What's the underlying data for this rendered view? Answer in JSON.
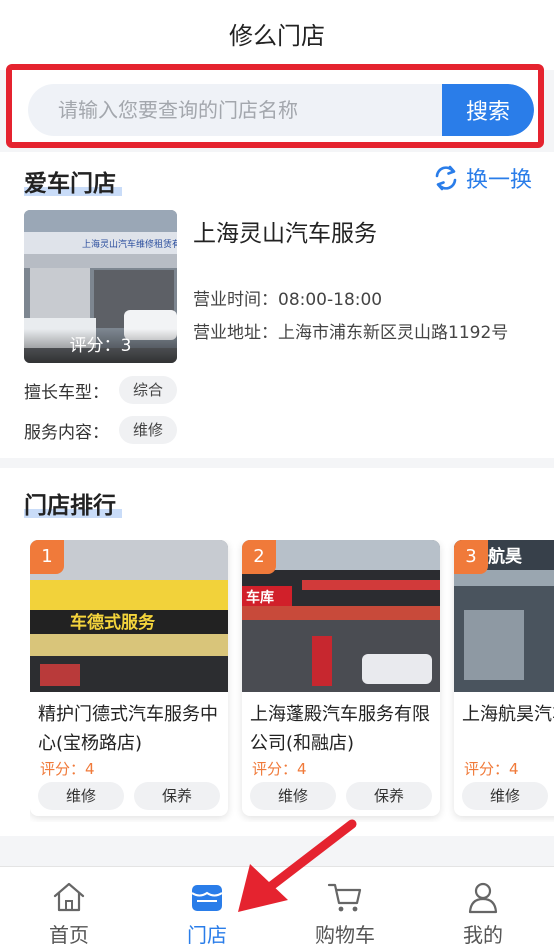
{
  "header": {
    "title": "修么门店"
  },
  "search": {
    "placeholder": "请输入您要查询的门店名称",
    "button_label": "搜索"
  },
  "favorite": {
    "section_title": "爱车门店",
    "swap_label": "换一换",
    "store": {
      "name": "上海灵山汽车服务",
      "rating_text": "评分：3",
      "hours": "营业时间：08:00-18:00",
      "address": "营业地址：上海市浦东新区灵山路1192号",
      "sign_text": "上海灵山汽车维修租赁有限公司",
      "specialty_label": "擅长车型：",
      "specialty_tag": "综合",
      "service_label": "服务内容：",
      "service_tag": "维修"
    }
  },
  "ranking": {
    "section_title": "门店排行",
    "items": [
      {
        "rank": "1",
        "name": "精护门德式汽车服务中心(宝杨路店)",
        "rating": "评分：4",
        "tags": [
          "维修",
          "保养"
        ],
        "sign_text": "车德式服务"
      },
      {
        "rank": "2",
        "name": "上海蓬殿汽车服务有限公司(和融店)",
        "rating": "评分：4",
        "tags": [
          "维修",
          "保养"
        ],
        "sign_text": "车库"
      },
      {
        "rank": "3",
        "name": "上海航昊汽车维修中心",
        "rating": "评分：4",
        "tags": [
          "维修"
        ],
        "sign_text": "航昊"
      }
    ]
  },
  "tabbar": {
    "tabs": [
      {
        "label": "首页",
        "icon": "home-icon"
      },
      {
        "label": "门店",
        "icon": "store-icon",
        "active": true
      },
      {
        "label": "购物车",
        "icon": "cart-icon"
      },
      {
        "label": "我的",
        "icon": "user-icon"
      }
    ]
  },
  "colors": {
    "accent": "#2a7de9",
    "highlight": "#e5232f",
    "rank_badge": "#f07a3a"
  }
}
